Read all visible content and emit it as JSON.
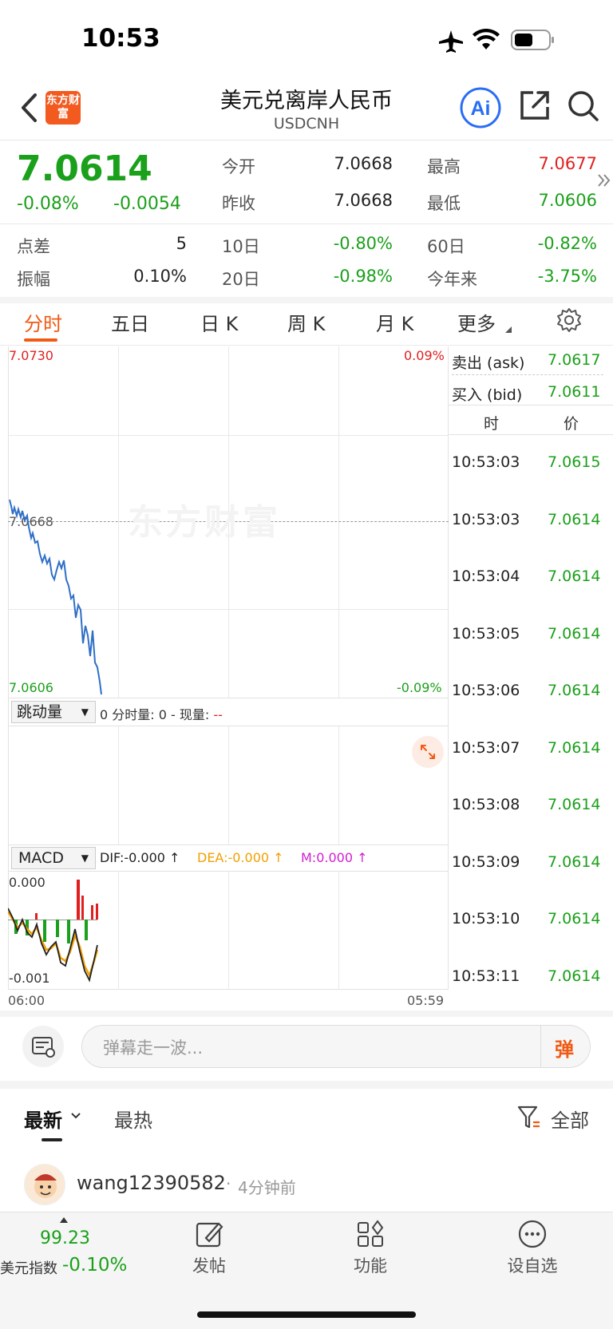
{
  "status_bar": {
    "time": "10:53"
  },
  "header": {
    "logo_text": "东方财富",
    "title": "美元兑离岸人民币",
    "subtitle": "USDCNH"
  },
  "quote": {
    "price": "7.0614",
    "change_pct": "-0.08%",
    "change": "-0.0054",
    "open_label": "今开",
    "open": "7.0668",
    "high_label": "最高",
    "high": "7.0677",
    "prev_close_label": "昨收",
    "prev_close": "7.0668",
    "low_label": "最低",
    "low": "7.0606",
    "spread_label": "点差",
    "spread": "5",
    "d10_label": "10日",
    "d10": "-0.80%",
    "d60_label": "60日",
    "d60": "-0.82%",
    "amplitude_label": "振幅",
    "amplitude": "0.10%",
    "d20_label": "20日",
    "d20": "-0.98%",
    "ytd_label": "今年来",
    "ytd": "-3.75%"
  },
  "tabs": [
    "分时",
    "五日",
    "日 K",
    "周 K",
    "月 K",
    "更多"
  ],
  "chart": {
    "y_top": "7.0730",
    "y_top_pct": "0.09%",
    "y_mid": "7.0668",
    "y_bottom": "7.0606",
    "y_bottom_pct": "-0.09%",
    "watermark": "东方财富",
    "volume_selector": "跳动量",
    "volume_info_prefix": "0 分时量: 0 - 现量: ",
    "volume_info_suffix": "--",
    "macd_selector": "MACD",
    "dif": "DIF:-0.000 ↑",
    "dea": "DEA:-0.000 ↑",
    "m": "M:0.000 ↑",
    "macd_top": "0.000",
    "macd_bottom": "-0.001",
    "x_start": "06:00",
    "x_end": "05:59"
  },
  "trade_panel": {
    "ask_label": "卖出 (ask)",
    "ask": "7.0617",
    "bid_label": "买入 (bid)",
    "bid": "7.0611",
    "col_time": "时",
    "col_price": "价",
    "rows": [
      {
        "time": "10:53:03",
        "price": "7.0615"
      },
      {
        "time": "10:53:03",
        "price": "7.0614"
      },
      {
        "time": "10:53:04",
        "price": "7.0614"
      },
      {
        "time": "10:53:05",
        "price": "7.0614"
      },
      {
        "time": "10:53:06",
        "price": "7.0614"
      },
      {
        "time": "10:53:07",
        "price": "7.0614"
      },
      {
        "time": "10:53:08",
        "price": "7.0614"
      },
      {
        "time": "10:53:09",
        "price": "7.0614"
      },
      {
        "time": "10:53:10",
        "price": "7.0614"
      },
      {
        "time": "10:53:11",
        "price": "7.0614"
      }
    ]
  },
  "comments": {
    "danmu_placeholder": "弹幕走一波...",
    "danmu_button": "弹",
    "tab_latest": "最新",
    "tab_hot": "最热",
    "filter_label": "全部",
    "post_user": "wang12390582",
    "post_time": "4分钟前"
  },
  "bottom_bar": {
    "index_value": "99.23",
    "index_name": "美元指数",
    "index_change": "-0.10%",
    "post_label": "发帖",
    "func_label": "功能",
    "watchlist_label": "设自选"
  }
}
